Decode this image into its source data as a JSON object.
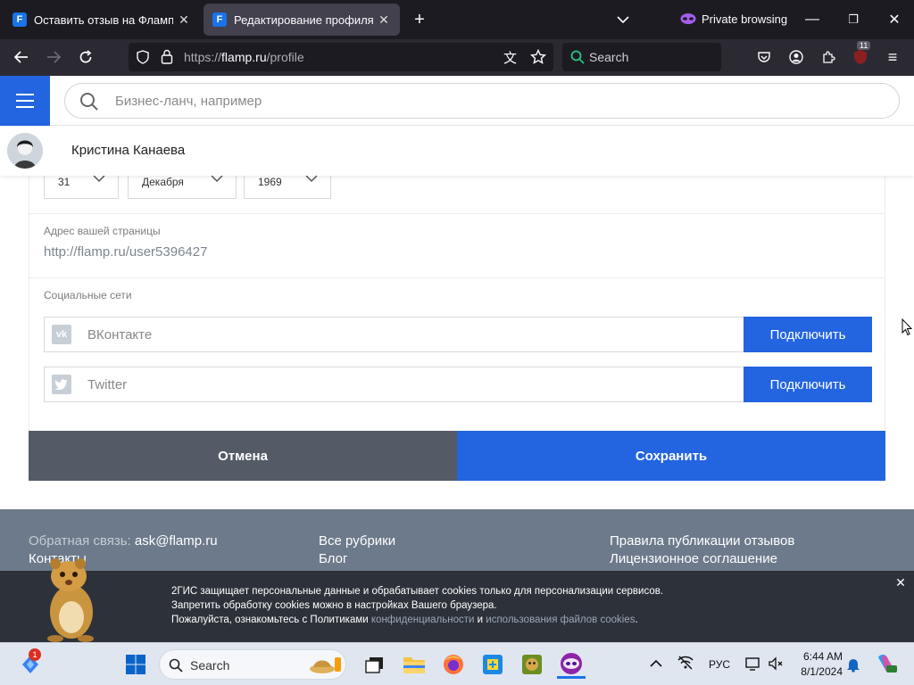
{
  "browser": {
    "tabs": [
      {
        "favicon": "F",
        "title": "Оставить отзыв на Флампе",
        "active": false
      },
      {
        "favicon": "F",
        "title": "Редактирование профиля",
        "active": true
      }
    ],
    "private_label": "Private browsing",
    "url_prefix": "https://",
    "url_host": "flamp.ru",
    "url_path": "/profile",
    "search_placeholder": "Search",
    "extensions_badge": "11"
  },
  "site": {
    "search_placeholder": "Бизнес-ланч, например",
    "user_name": "Кристина Канаева"
  },
  "profile": {
    "birth_day": "31",
    "birth_month": "Декабря",
    "birth_year": "1969",
    "page_address_label": "Адрес вашей страницы",
    "page_address": "http://flamp.ru/user5396427",
    "social_label": "Социальные сети",
    "socials": [
      {
        "name": "ВКонтакте",
        "icon": "vk-icon",
        "button": "Подключить"
      },
      {
        "name": "Twitter",
        "icon": "twitter-icon",
        "button": "Подключить"
      }
    ],
    "cancel_label": "Отмена",
    "save_label": "Сохранить"
  },
  "footer": {
    "feedback_label": "Обратная связь:",
    "feedback_email": "ask@flamp.ru",
    "contacts": "Контакты",
    "all_categories": "Все рубрики",
    "blog": "Блог",
    "rules": "Правила публикации отзывов",
    "license": "Лицензионное соглашение"
  },
  "cookie": {
    "line1": "2ГИС защищает персональные данные и обрабатывает cookies только для персонализации сервисов.",
    "line2": "Запретить обработку cookies можно в настройках Вашего браузера.",
    "line3_prefix": "Пожалуйста, ознакомьтесь с Политиками",
    "link1": "конфиденциальности",
    "and": "и",
    "link2": "использования файлов cookies",
    "dot": "."
  },
  "taskbar": {
    "search_label": "Search",
    "notification_badge": "1",
    "language": "РУС",
    "time": "6:44 AM",
    "date": "8/1/2024"
  },
  "colors": {
    "accent": "#2364e0",
    "cancel": "#545b66",
    "footer": "#6d7a8b"
  }
}
